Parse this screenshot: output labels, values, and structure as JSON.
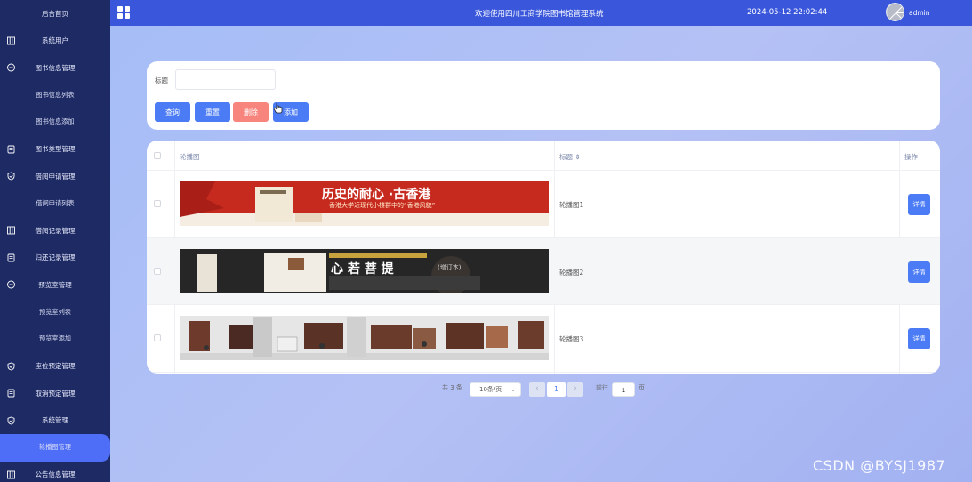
{
  "sidebar": {
    "items": [
      {
        "label": "后台首页",
        "icon": "",
        "sub": false
      },
      {
        "label": "系统用户",
        "icon": "columns-icon",
        "sub": false
      },
      {
        "label": "图书信息管理",
        "icon": "chat-icon",
        "sub": false
      },
      {
        "label": "图书信息列表",
        "icon": "",
        "sub": true
      },
      {
        "label": "图书信息添加",
        "icon": "",
        "sub": true
      },
      {
        "label": "图书类型管理",
        "icon": "document-icon",
        "sub": false
      },
      {
        "label": "借阅申请管理",
        "icon": "shield-check-icon",
        "sub": false
      },
      {
        "label": "借阅申请列表",
        "icon": "",
        "sub": true
      },
      {
        "label": "借阅记录管理",
        "icon": "columns-icon",
        "sub": false
      },
      {
        "label": "归还记录管理",
        "icon": "document-icon",
        "sub": false
      },
      {
        "label": "预览室管理",
        "icon": "chat-icon",
        "sub": false
      },
      {
        "label": "预览室列表",
        "icon": "",
        "sub": true
      },
      {
        "label": "预览室添加",
        "icon": "",
        "sub": true
      },
      {
        "label": "座位预定管理",
        "icon": "shield-check-icon",
        "sub": false
      },
      {
        "label": "取消预定管理",
        "icon": "document-icon",
        "sub": false
      },
      {
        "label": "系统管理",
        "icon": "shield-check-icon",
        "sub": false
      },
      {
        "label": "轮播图管理",
        "icon": "",
        "sub": true,
        "active": true
      },
      {
        "label": "公告信息管理",
        "icon": "columns-icon",
        "sub": false
      }
    ]
  },
  "header": {
    "title": "欢迎使用四川工商学院图书馆管理系统",
    "datetime": "2024-05-12 22:02:44",
    "username": "admin",
    "menu_icon": "grid-icon"
  },
  "search": {
    "title_label": "标题",
    "title_value": "",
    "title_placeholder": "",
    "query_label": "查询",
    "reset_label": "重置",
    "delete_label": "删除",
    "add_label": "添加"
  },
  "table": {
    "headers": {
      "image": "轮播图",
      "source": "标题 ⇕",
      "ops": "操作"
    },
    "rows": [
      {
        "source": "轮播图1",
        "detail": "详情",
        "banner_text": "历史的耐心 ·古香港",
        "banner_sub": "香港大学近现代小楼群中的“香港风貌”"
      },
      {
        "source": "轮播图2",
        "detail": "详情",
        "banner_text": "心 若 菩 提",
        "banner_sub": "(增订本)"
      },
      {
        "source": "轮播图3",
        "detail": "详情",
        "banner_text": "",
        "banner_sub": ""
      }
    ]
  },
  "pagination": {
    "total": "共 3 条",
    "page_size": "10条/页",
    "current": "1",
    "goto_label": "前往",
    "goto_value": "1",
    "page_suffix": "页"
  },
  "watermark": "CSDN @BYSJ1987",
  "colors": {
    "sidebar": "#1e2a63",
    "topbar": "#3a57db",
    "primary": "#4c7cf5",
    "danger": "#f7857e",
    "active": "#4f6ef7"
  }
}
